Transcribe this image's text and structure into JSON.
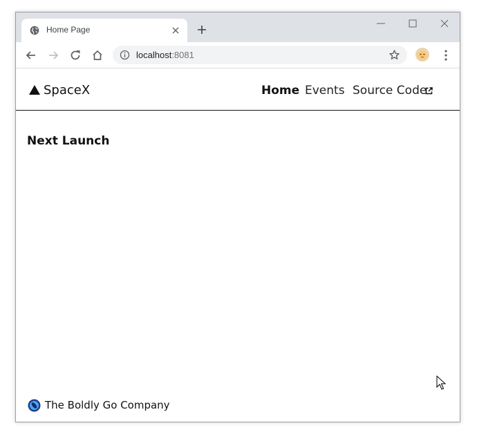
{
  "browser": {
    "tab_title": "Home Page",
    "url_host": "localhost",
    "url_port": ":8081"
  },
  "site": {
    "brand": "SpaceX",
    "nav": [
      {
        "label": "Home",
        "active": true
      },
      {
        "label": "Events",
        "active": false
      },
      {
        "label": "Source Code",
        "active": false,
        "external": true
      }
    ],
    "section_title": "Next Launch",
    "footer_text": "The Boldly Go Company"
  },
  "icons": {
    "favicon": "globe-icon",
    "brand": "triangle-logo-icon",
    "external": "external-link-icon",
    "footer": "company-logo-icon"
  },
  "colors": {
    "tab_strip": "#dee1e6",
    "omnibox": "#f1f3f4",
    "text": "#111111",
    "footer_logo": "#2a7ec9"
  }
}
